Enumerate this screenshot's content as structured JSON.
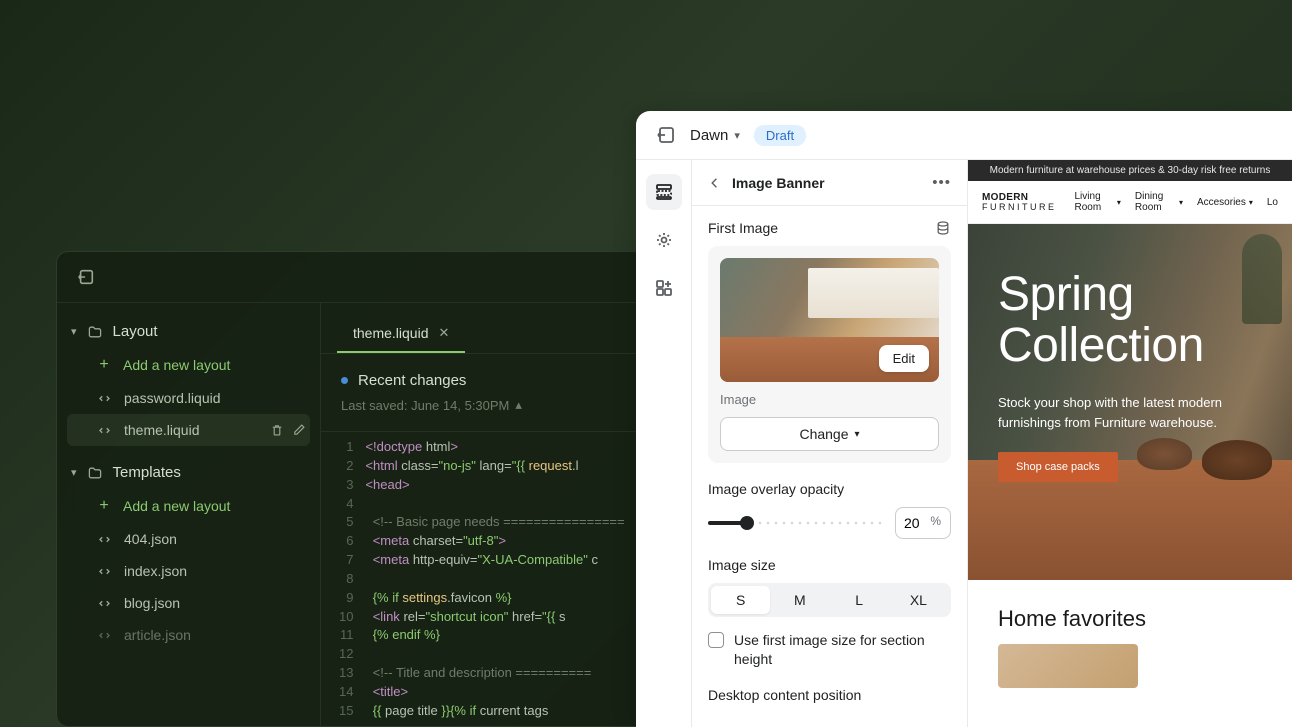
{
  "editor": {
    "tab": "theme.liquid",
    "recent_changes": "Recent changes",
    "last_saved": "Last saved: June 14, 5:30PM",
    "sidebar": {
      "layout_section": "Layout",
      "add_layout": "Add a new layout",
      "layout_files": [
        "password.liquid",
        "theme.liquid"
      ],
      "templates_section": "Templates",
      "add_template": "Add a new layout",
      "template_files": [
        "404.json",
        "index.json",
        "blog.json",
        "article.json"
      ]
    },
    "code_lines": [
      {
        "n": "1",
        "html": "<span class='tok-tag'>&lt;!doctype</span> <span class='tok-attr'>html</span><span class='tok-tag'>&gt;</span>"
      },
      {
        "n": "2",
        "html": "<span class='tok-tag'>&lt;html</span> <span class='tok-attr'>class</span>=<span class='tok-str'>\"no-js\"</span> <span class='tok-attr'>lang</span>=<span class='tok-str'>\"</span><span class='tok-liq'>{{</span> <span class='tok-var'>request</span>.l"
      },
      {
        "n": "3",
        "html": "<span class='tok-tag'>&lt;head&gt;</span>"
      },
      {
        "n": "4",
        "html": ""
      },
      {
        "n": "5",
        "html": "  <span class='tok-cmt'>&lt;!-- Basic page needs ================</span>"
      },
      {
        "n": "6",
        "html": "  <span class='tok-tag'>&lt;meta</span> <span class='tok-attr'>charset</span>=<span class='tok-str'>\"utf-8\"</span><span class='tok-tag'>&gt;</span>"
      },
      {
        "n": "7",
        "html": "  <span class='tok-tag'>&lt;meta</span> <span class='tok-attr'>http-equiv</span>=<span class='tok-str'>\"X-UA-Compatible\"</span> c"
      },
      {
        "n": "8",
        "html": ""
      },
      {
        "n": "9",
        "html": "  <span class='tok-liq'>{% if</span> <span class='tok-var'>settings</span>.favicon <span class='tok-liq'>%}</span>"
      },
      {
        "n": "10",
        "html": "  <span class='tok-tag'>&lt;link</span> <span class='tok-attr'>rel</span>=<span class='tok-str'>\"shortcut icon\"</span> <span class='tok-attr'>href</span>=<span class='tok-str'>\"</span><span class='tok-liq'>{{</span> s"
      },
      {
        "n": "11",
        "html": "  <span class='tok-liq'>{% endif %}</span>"
      },
      {
        "n": "12",
        "html": ""
      },
      {
        "n": "13",
        "html": "  <span class='tok-cmt'>&lt;!-- Title and description ==========</span>"
      },
      {
        "n": "14",
        "html": "  <span class='tok-tag'>&lt;title&gt;</span>"
      },
      {
        "n": "15",
        "html": "  <span class='tok-liq'>{{</span> page title <span class='tok-liq'>}}{% if</span> current tags"
      }
    ]
  },
  "customizer": {
    "theme_name": "Dawn",
    "status_badge": "Draft",
    "panel": {
      "title": "Image Banner",
      "first_image_label": "First Image",
      "image_sublabel": "Image",
      "edit_btn": "Edit",
      "change_btn": "Change",
      "opacity_label": "Image overlay opacity",
      "opacity_value": "20",
      "size_label": "Image size",
      "sizes": [
        "S",
        "M",
        "L",
        "XL"
      ],
      "checkbox_label": "Use first image size for section height",
      "desktop_position_label": "Desktop content position"
    }
  },
  "storefront": {
    "promo": "Modern furniture at warehouse prices & 30-day risk free returns",
    "brand_line1": "MODERN",
    "brand_line2": "FURNITURE",
    "nav": [
      "Living Room",
      "Dining Room",
      "Accesories",
      "Lo"
    ],
    "hero_title_1": "Spring",
    "hero_title_2": "Collection",
    "hero_body": "Stock your shop with the latest modern furnishings from Furniture warehouse.",
    "hero_cta": "Shop case packs",
    "favorites_title": "Home favorites"
  }
}
